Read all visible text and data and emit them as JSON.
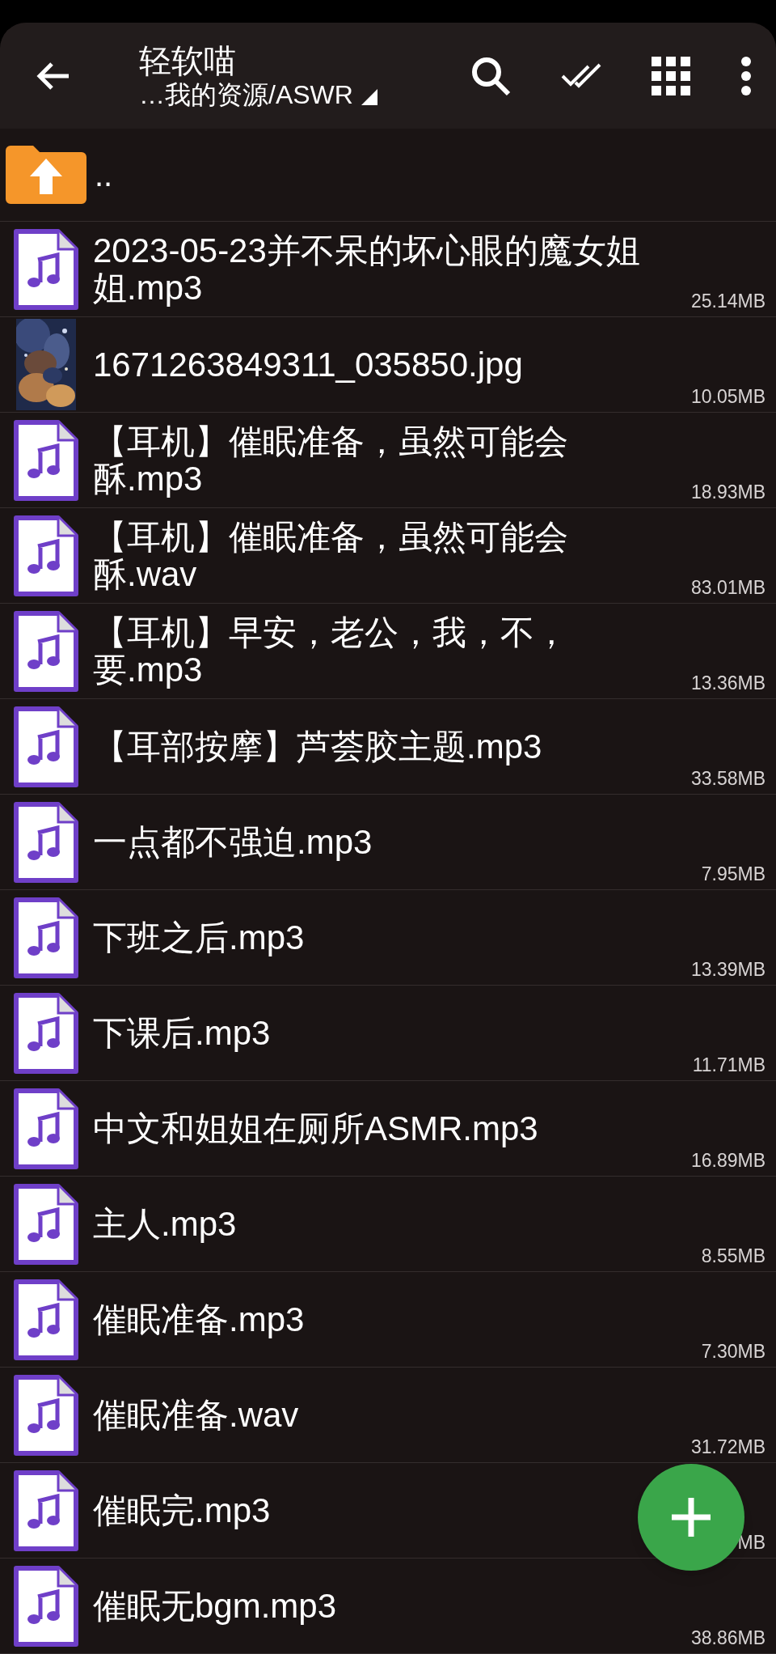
{
  "toolbar": {
    "title": "轻软喵",
    "path": "…我的资源/ASWR"
  },
  "parent_entry": {
    "label": ".."
  },
  "files": [
    {
      "kind": "audio",
      "name_lines": [
        "2023-05-23并不呆的坏心眼的魔女姐",
        "姐.mp3"
      ],
      "size": "25.14MB"
    },
    {
      "name_lines": [
        "1671263849311_035850.jpg"
      ],
      "size": "10.05MB"
    },
    {
      "kind": "audio",
      "name_lines": [
        "【耳机】催眠准备，虽然可能会",
        "酥.mp3"
      ],
      "size": "18.93MB"
    },
    {
      "kind": "audio",
      "name_lines": [
        "【耳机】催眠准备，虽然可能会",
        "酥.wav"
      ],
      "size": "83.01MB"
    },
    {
      "kind": "audio",
      "name_lines": [
        "【耳机】早安，老公，我，不，",
        "要.mp3"
      ],
      "size": "13.36MB"
    },
    {
      "kind": "audio",
      "name_lines": [
        "【耳部按摩】芦荟胶主题.mp3"
      ],
      "size": "33.58MB"
    },
    {
      "kind": "audio",
      "name_lines": [
        "一点都不强迫.mp3"
      ],
      "size": "7.95MB"
    },
    {
      "kind": "audio",
      "name_lines": [
        "下班之后.mp3"
      ],
      "size": "13.39MB"
    },
    {
      "kind": "audio",
      "name_lines": [
        "下课后.mp3"
      ],
      "size": "11.71MB"
    },
    {
      "kind": "audio",
      "name_lines": [
        "中文和姐姐在厕所ASMR.mp3"
      ],
      "size": "16.89MB"
    },
    {
      "kind": "audio",
      "name_lines": [
        "主人.mp3"
      ],
      "size": "8.55MB"
    },
    {
      "kind": "audio",
      "name_lines": [
        "催眠准备.mp3"
      ],
      "size": "7.30MB"
    },
    {
      "kind": "audio",
      "name_lines": [
        "催眠准备.wav"
      ],
      "size": "31.72MB"
    },
    {
      "kind": "audio",
      "name_lines": [
        "催眠完.mp3"
      ],
      "size": "MB"
    },
    {
      "kind": "audio",
      "name_lines": [
        "催眠无bgm.mp3"
      ],
      "size": "38.86MB"
    }
  ]
}
